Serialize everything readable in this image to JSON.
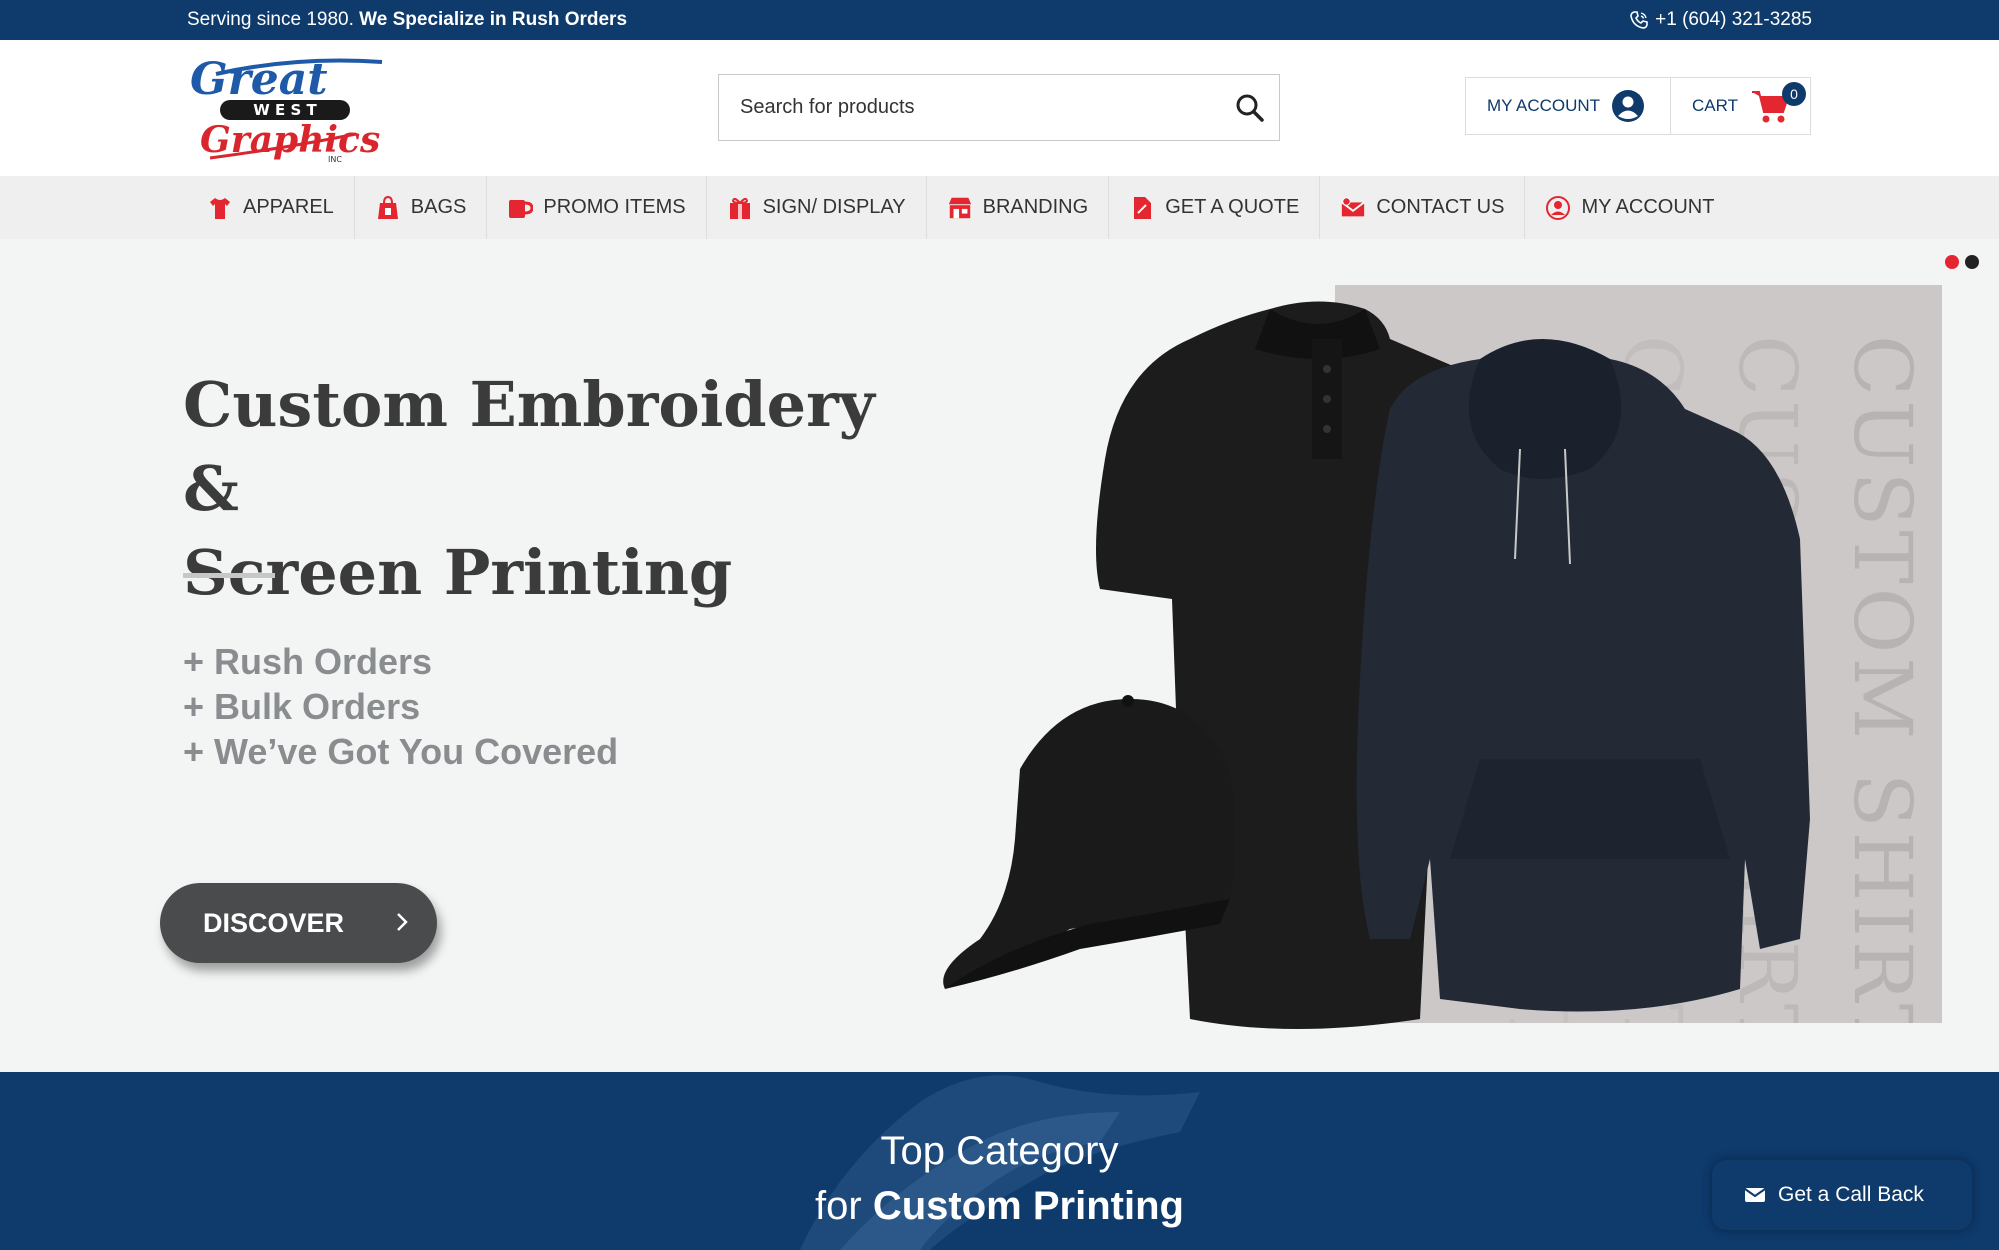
{
  "topbar": {
    "tagline_plain": "Serving since 1980.",
    "tagline_bold": "We Specialize in Rush Orders",
    "phone": "+1 (604) 321-3285"
  },
  "header": {
    "logo_alt": "Great West Graphics Inc",
    "logo_text": {
      "top": "Great",
      "middle": "W E S T",
      "bottom": "Graphics",
      "suffix": "INC"
    },
    "search": {
      "placeholder": "Search for products",
      "value": ""
    },
    "account_label": "MY ACCOUNT",
    "cart_label": "CART",
    "cart_count": "0"
  },
  "nav": {
    "items": [
      {
        "label": "APPAREL",
        "icon": "tshirt-icon"
      },
      {
        "label": "BAGS",
        "icon": "bag-icon"
      },
      {
        "label": "PROMO ITEMS",
        "icon": "mug-icon"
      },
      {
        "label": "SIGN/ DISPLAY",
        "icon": "sign-icon"
      },
      {
        "label": "BRANDING",
        "icon": "store-icon"
      },
      {
        "label": "GET A QUOTE",
        "icon": "document-icon"
      },
      {
        "label": "CONTACT US",
        "icon": "envelope-icon"
      },
      {
        "label": "MY ACCOUNT",
        "icon": "user-circle-icon"
      }
    ]
  },
  "hero": {
    "title_line1": "Custom Embroidery &",
    "title_line2": "Screen Printing",
    "bullets": [
      "+ Rush Orders",
      "+ Bulk Orders",
      "+ We’ve Got You Covered"
    ],
    "cta_label": "DISCOVER",
    "panel_text": "CUSTOM SHIRTS",
    "slide_count": 2,
    "active_slide": 1
  },
  "category": {
    "title": "Top Category",
    "sub_plain": "for ",
    "sub_bold": "Custom Printing"
  },
  "callback": {
    "label": "Get a Call Back"
  },
  "colors": {
    "navy": "#0e3a6c",
    "accent_red": "#e3262f",
    "dark_button": "#4a4b4c",
    "hero_bg": "#f3f4f4"
  }
}
